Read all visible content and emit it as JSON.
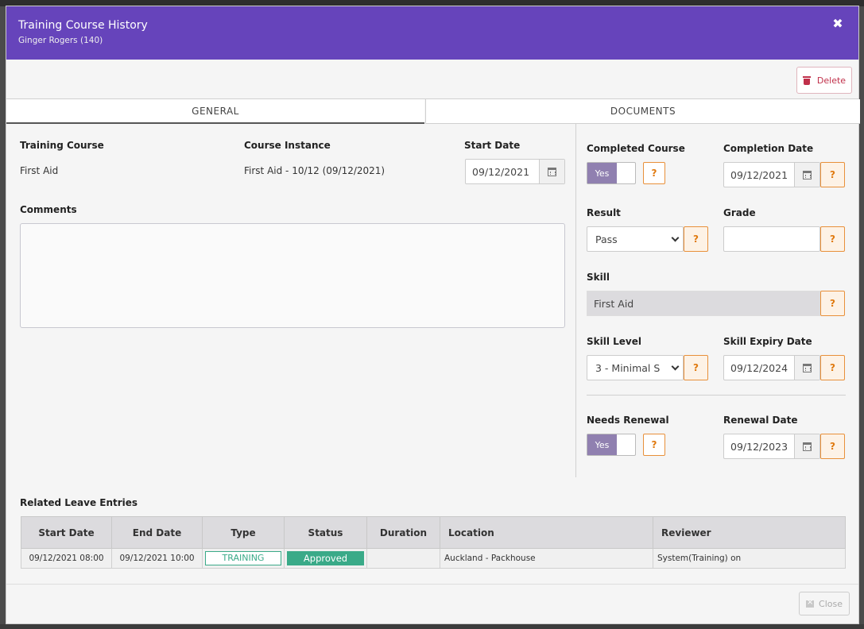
{
  "modal": {
    "title": "Training Course History",
    "subtitle": "Ginger Rogers (140)",
    "close_glyph": "✖"
  },
  "toolbar": {
    "delete_label": "Delete"
  },
  "tabs": [
    {
      "label": "GENERAL",
      "active": true
    },
    {
      "label": "DOCUMENTS",
      "active": false
    }
  ],
  "general": {
    "training_course_label": "Training Course",
    "training_course_value": "First Aid",
    "course_instance_label": "Course Instance",
    "course_instance_value": "First Aid - 10/12 (09/12/2021)",
    "start_date_label": "Start Date",
    "start_date_value": "09/12/2021",
    "comments_label": "Comments",
    "comments_value": ""
  },
  "side": {
    "completed_course_label": "Completed Course",
    "completed_course_toggle": "Yes",
    "completion_date_label": "Completion Date",
    "completion_date_value": "09/12/2021",
    "result_label": "Result",
    "result_value": "Pass",
    "grade_label": "Grade",
    "grade_value": "",
    "skill_label": "Skill",
    "skill_value": "First Aid",
    "skill_level_label": "Skill Level",
    "skill_level_value": "3 - Minimal S",
    "skill_expiry_label": "Skill Expiry Date",
    "skill_expiry_value": "09/12/2024",
    "needs_renewal_label": "Needs Renewal",
    "needs_renewal_toggle": "Yes",
    "renewal_date_label": "Renewal Date",
    "renewal_date_value": "09/12/2023",
    "help_glyph": "?"
  },
  "leave": {
    "section_label": "Related Leave Entries",
    "columns": [
      "Start Date",
      "End Date",
      "Type",
      "Status",
      "Duration",
      "Location",
      "Reviewer"
    ],
    "rows": [
      {
        "start": "09/12/2021 08:00",
        "end": "09/12/2021 10:00",
        "type": "TRAINING",
        "status": "Approved",
        "duration": "",
        "location": "Auckland - Packhouse",
        "reviewer": "System(Training) on"
      }
    ]
  },
  "footer": {
    "close_label": "Close"
  },
  "colors": {
    "header": "#6644bb",
    "help_accent": "#e8903a",
    "status_green": "#3aaa88",
    "delete_red": "#c0304a",
    "toggle_on": "#9080b0"
  },
  "icons": {
    "close": "close-icon",
    "delete": "trash-icon",
    "calendar": "calendar-icon",
    "dropdown": "chevron-down-icon"
  }
}
